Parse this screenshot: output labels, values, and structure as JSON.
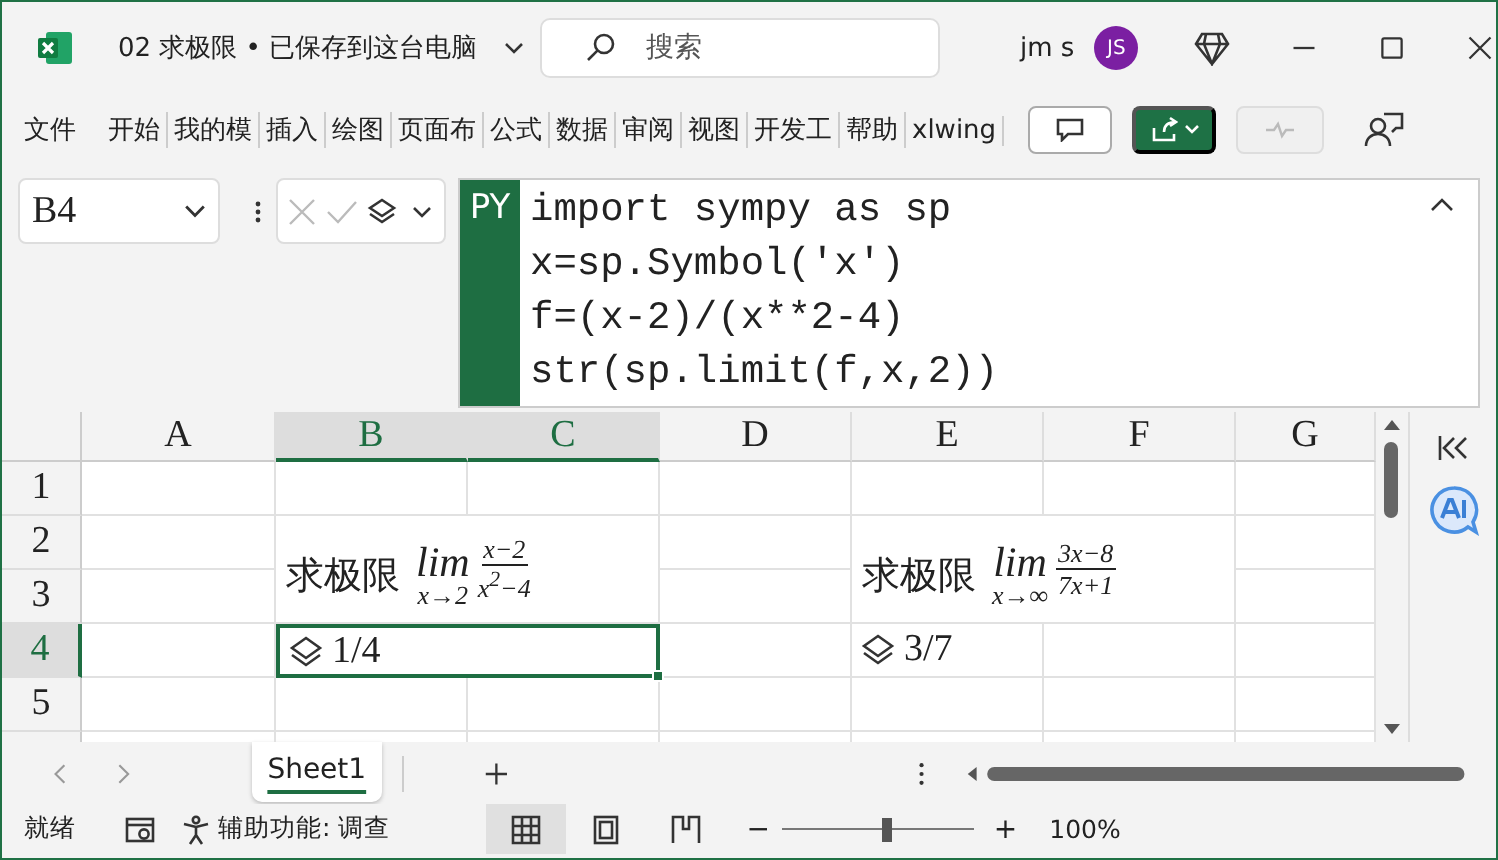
{
  "title_bar": {
    "file_title": "02 求极限 • 已保存到这台电脑",
    "search_placeholder": "搜索",
    "user_name": "jm s",
    "avatar_initials": "JS"
  },
  "ribbon": {
    "tabs": [
      {
        "label": "文件"
      },
      {
        "label": "开始"
      },
      {
        "label": "我的模"
      },
      {
        "label": "插入"
      },
      {
        "label": "绘图"
      },
      {
        "label": "页面布"
      },
      {
        "label": "公式"
      },
      {
        "label": "数据"
      },
      {
        "label": "审阅"
      },
      {
        "label": "视图"
      },
      {
        "label": "开发工"
      },
      {
        "label": "帮助"
      },
      {
        "label": "xlwing"
      }
    ]
  },
  "formula_bar": {
    "name_box": "B4",
    "badge": "PY",
    "code_lines": [
      "import sympy as sp",
      "x=sp.Symbol('x')",
      "f=(x-2)/(x**2-4)",
      "str(sp.limit(f,x,2))"
    ]
  },
  "sheet": {
    "columns": [
      {
        "label": "A",
        "selected": false
      },
      {
        "label": "B",
        "selected": true
      },
      {
        "label": "C",
        "selected": true
      },
      {
        "label": "D",
        "selected": false
      },
      {
        "label": "E",
        "selected": false
      },
      {
        "label": "F",
        "selected": false
      },
      {
        "label": "G",
        "selected": false
      }
    ],
    "rows": [
      {
        "label": "1",
        "selected": false
      },
      {
        "label": "2",
        "selected": false
      },
      {
        "label": "3",
        "selected": false
      },
      {
        "label": "4",
        "selected": true
      },
      {
        "label": "5",
        "selected": false
      }
    ],
    "formulas": [
      {
        "label": "求极限",
        "lim": "lim",
        "approach": "x→2",
        "numerator": "x−2",
        "denominator": "x$^{2}$−4"
      },
      {
        "label": "求极限",
        "lim": "lim",
        "approach": "x→∞",
        "numerator": "3x−8",
        "denominator": "7x+1"
      }
    ],
    "results": [
      {
        "text": "1/4",
        "selected": true
      },
      {
        "text": "3/7",
        "selected": false
      }
    ]
  },
  "sheet_tabs": [
    {
      "label": "Sheet1",
      "selected": true
    }
  ],
  "status_bar": {
    "ready": "就绪",
    "accessibility": "辅助功能: 调查",
    "zoom_minus": "−",
    "zoom_plus": "+",
    "zoom": "100%",
    "zoom_slider": {
      "level": 0.55
    }
  }
}
